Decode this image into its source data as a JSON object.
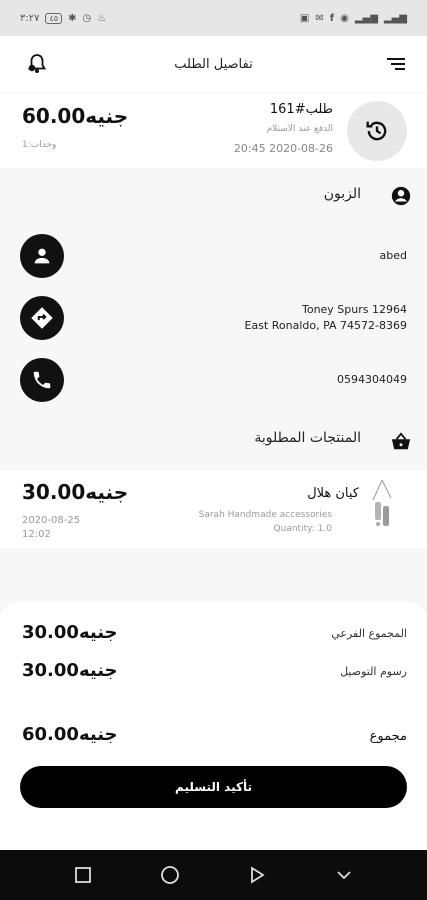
{
  "status_bar": {
    "time": "٣:٢٧",
    "battery": "٤٥"
  },
  "app_bar": {
    "title": "تفاصيل الطلب",
    "bell_icon": "bell-icon",
    "menu_icon": "menu-icon"
  },
  "order": {
    "price": "60.00جنيه",
    "units": "وحدات:1",
    "number": "طلب#161",
    "payment": "الدفع عند الاستلام",
    "date": "20:45 2020-08-26",
    "status_icon": "history-icon"
  },
  "customer": {
    "section_title": "الزبون",
    "section_icon": "account-circle-icon",
    "name": "abed",
    "address_line1": "Toney Spurs 12964",
    "address_line2": "East Ronaldo, PA 74572-8369",
    "phone": "0594304049"
  },
  "products": {
    "section_title": "المنتجات المطلوبة",
    "section_icon": "basket-icon",
    "items": [
      {
        "price": "30.00جنيه",
        "date": "2020-08-25",
        "time": "12:02",
        "name": "كيان هلال",
        "store": "Sarah Handmade accessories",
        "quantity": "Quantity: 1.0"
      }
    ]
  },
  "summary": {
    "subtotal_label": "المجموع الفرعي",
    "subtotal_value": "30.00جنيه",
    "delivery_label": "رسوم التوصيل",
    "delivery_value": "30.00جنيه",
    "total_label": "مجموع",
    "total_value": "60.00جنيه"
  },
  "confirm_button": "تأكيد التسليم",
  "colors": {
    "primary": "#000000",
    "background": "#f7f7f7",
    "card": "#ffffff"
  }
}
